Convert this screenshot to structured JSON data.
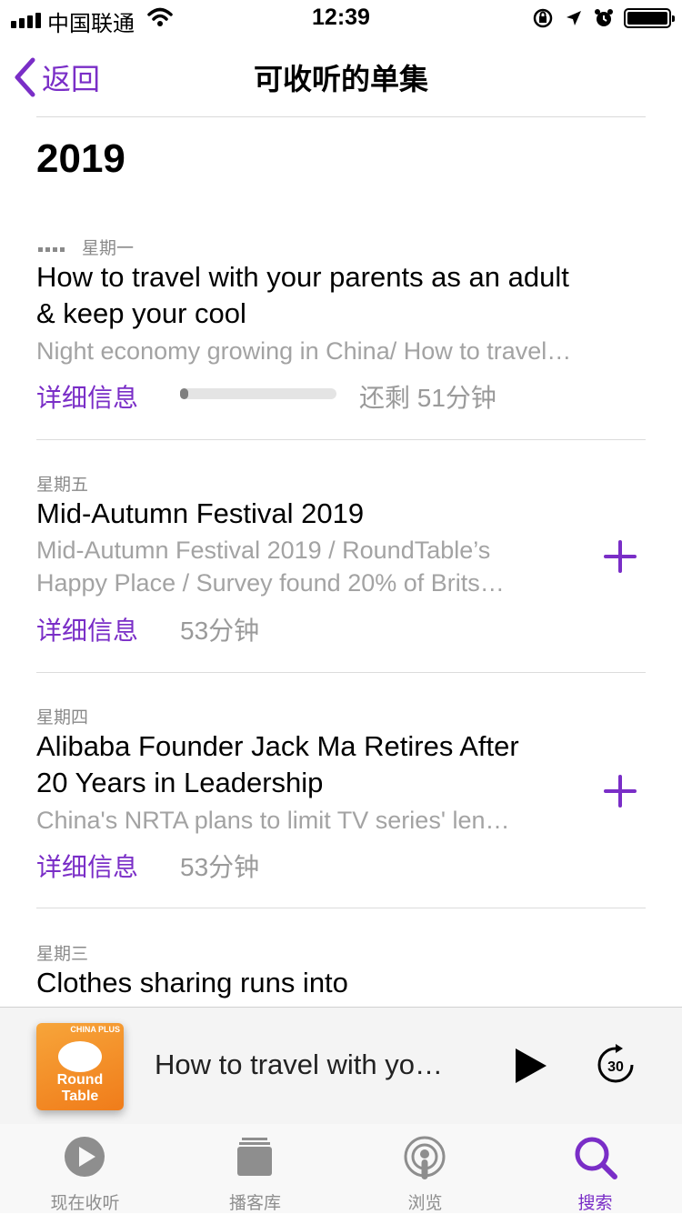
{
  "status_bar": {
    "carrier": "中国联通",
    "time": "12:39"
  },
  "nav": {
    "back_label": "返回",
    "title": "可收听的单集"
  },
  "section": {
    "year": "2019"
  },
  "episodes": [
    {
      "day": "星期一",
      "title_lines": [
        "How to travel with your parents as an adult",
        "& keep your cool"
      ],
      "desc_lines": [
        "Night economy growing in China/ How to travel…"
      ],
      "details_label": "详细信息",
      "duration": "还剩 51分钟",
      "progress_fraction": 0.05
    },
    {
      "day": "星期五",
      "title_lines": [
        "Mid-Autumn Festival 2019"
      ],
      "desc_lines": [
        "Mid-Autumn Festival 2019 / RoundTable’s",
        "Happy Place / Survey found 20% of Brits…"
      ],
      "details_label": "详细信息",
      "duration": "53分钟"
    },
    {
      "day": "星期四",
      "title_lines": [
        "Alibaba Founder Jack Ma Retires After",
        "20 Years in Leadership"
      ],
      "desc_lines": [
        "China's NRTA plans to limit TV series' len…"
      ],
      "details_label": "详细信息",
      "duration": "53分钟"
    },
    {
      "day": "星期三",
      "title_lines": [
        "Clothes sharing runs into"
      ]
    }
  ],
  "mini_player": {
    "title": "How to travel with yo…",
    "artwork_text": [
      "CHINA PLUS",
      "Round",
      "Table"
    ],
    "skip_seconds": "30"
  },
  "tabs": [
    {
      "label": "现在收听",
      "icon": "play-circle-icon",
      "active": false
    },
    {
      "label": "播客库",
      "icon": "library-icon",
      "active": false
    },
    {
      "label": "浏览",
      "icon": "podcast-icon",
      "active": false
    },
    {
      "label": "搜索",
      "icon": "search-icon",
      "active": true
    }
  ],
  "colors": {
    "accent": "#7a2ec7",
    "secondary_text": "#a3a3a3"
  }
}
